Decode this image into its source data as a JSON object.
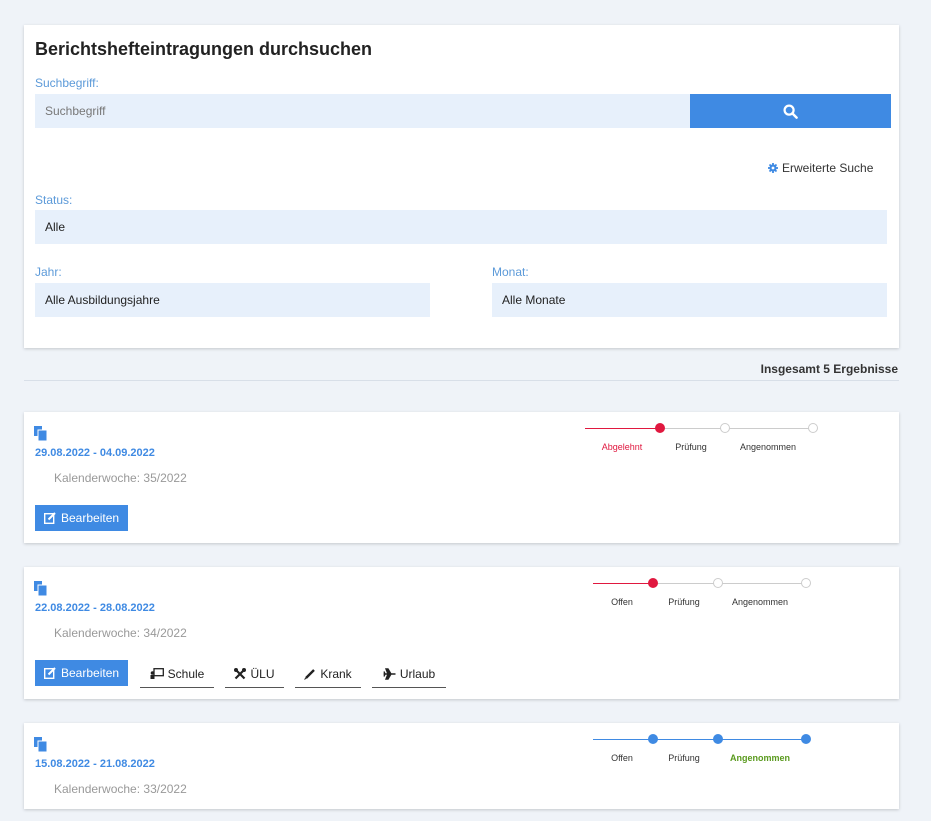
{
  "search": {
    "title": "Berichtshefteintragungen durchsuchen",
    "term_label": "Suchbegriff:",
    "term_placeholder": "Suchbegriff",
    "advanced": "Erweiterte Suche",
    "status_label": "Status:",
    "status_value": "Alle",
    "year_label": "Jahr:",
    "year_value": "Alle Ausbildungsjahre",
    "month_label": "Monat:",
    "month_value": "Alle Monate"
  },
  "results_count": "Insgesamt 5 Ergebnisse",
  "colors": {
    "accent": "#3f8ae3",
    "rejected": "#e0183f",
    "accepted": "#5a9a1e",
    "field_bg": "#e7f0fb"
  },
  "entries": [
    {
      "date_range": "29.08.2022 - 04.09.2022",
      "week": "Kalenderwoche: 35/2022",
      "edit_label": "Bearbeiten",
      "steps": [
        "Abgelehnt",
        "Prüfung",
        "Angenommen"
      ],
      "state": "rejected"
    },
    {
      "date_range": "22.08.2022 - 28.08.2022",
      "week": "Kalenderwoche: 34/2022",
      "edit_label": "Bearbeiten",
      "steps": [
        "Offen",
        "Prüfung",
        "Angenommen"
      ],
      "state": "open",
      "quick_actions": [
        "Schule",
        "ÜLU",
        "Krank",
        "Urlaub"
      ]
    },
    {
      "date_range": "15.08.2022 - 21.08.2022",
      "week": "Kalenderwoche: 33/2022",
      "steps": [
        "Offen",
        "Prüfung",
        "Angenommen"
      ],
      "state": "accepted"
    }
  ]
}
